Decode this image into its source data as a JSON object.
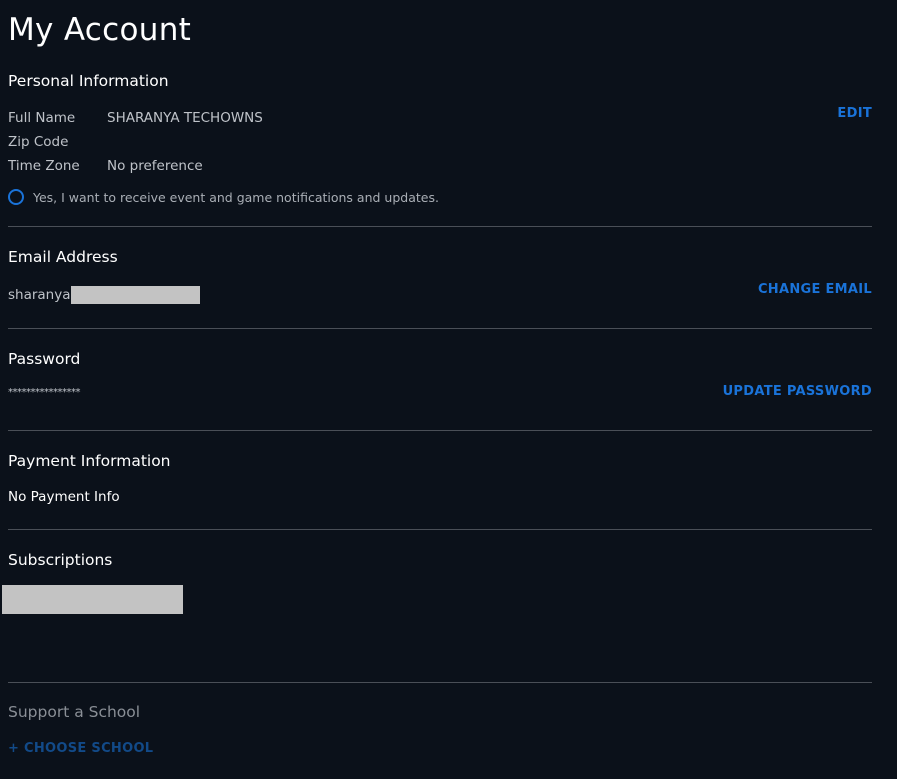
{
  "page": {
    "title": "My Account"
  },
  "personal_info": {
    "heading": "Personal Information",
    "edit_label": "EDIT",
    "fields": [
      {
        "label": "Full Name",
        "value": "SHARANYA TECHOWNS"
      },
      {
        "label": "Zip Code",
        "value": ""
      },
      {
        "label": "Time Zone",
        "value": "No preference"
      }
    ],
    "notifications": {
      "label": "Yes, I want to receive event and game notifications and updates.",
      "checked": false
    }
  },
  "email": {
    "heading": "Email Address",
    "value_visible": "sharanya",
    "value_redacted": true,
    "action_label": "CHANGE EMAIL"
  },
  "password": {
    "heading": "Password",
    "masked_value": "****************",
    "action_label": "UPDATE PASSWORD"
  },
  "payment": {
    "heading": "Payment Information",
    "value": "No Payment Info"
  },
  "subscriptions": {
    "heading": "Subscriptions",
    "value_redacted": true
  },
  "support_school": {
    "heading": "Support a School",
    "action_label": "+ CHOOSE SCHOOL"
  },
  "colors": {
    "background": "#0b111a",
    "accent": "#1a73d9",
    "accent_dim": "#124a88",
    "divider": "#4a4f57",
    "redaction": "#c3c3c3"
  }
}
